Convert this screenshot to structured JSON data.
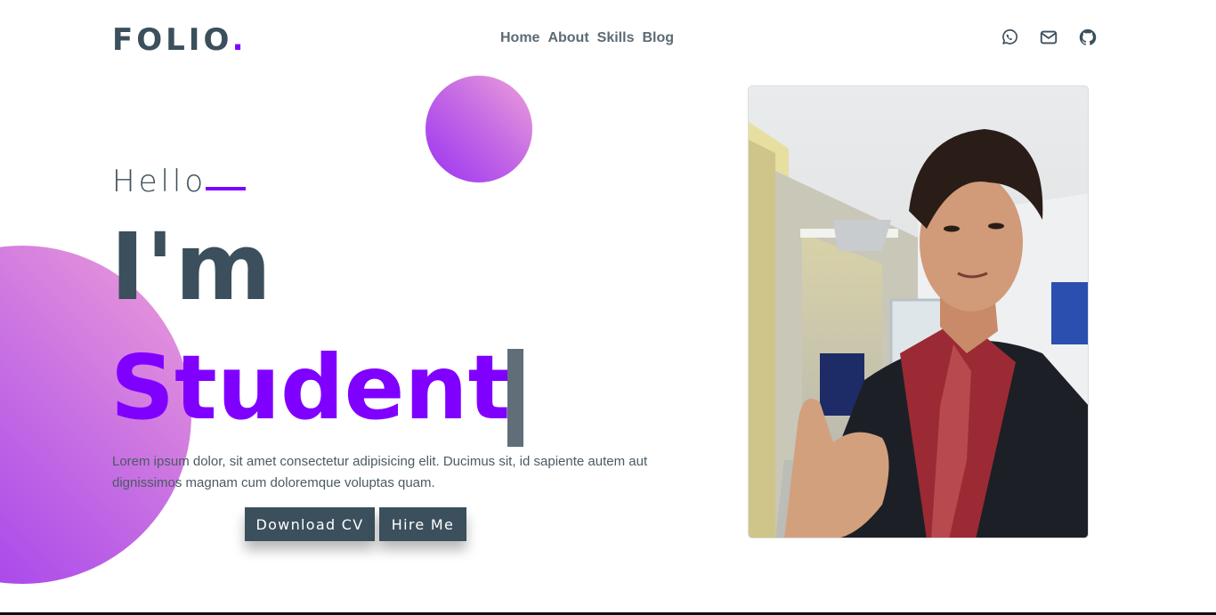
{
  "navbar": {
    "brand": "FOLIO",
    "brand_dot": ".",
    "links": [
      "Home",
      "About",
      "Skills",
      "Blog"
    ],
    "social_icons": [
      "whatsapp-icon",
      "mail-icon",
      "github-icon"
    ]
  },
  "hero": {
    "greeting": "Hello",
    "intro": "I'm",
    "role": "Student",
    "description": "Lorem ipsum dolor, sit amet consectetur adipisicing elit. Ducimus sit, id sapiente autem aut dignissimos magnam cum doloremque voluptas quam.",
    "buttons": {
      "download": "Download CV",
      "hire": "Hire Me"
    }
  },
  "colors": {
    "primary": "#3b4f5c",
    "accent": "#8000ff",
    "gradient_start": "#9b33f0",
    "gradient_end": "#ee9fd9"
  }
}
